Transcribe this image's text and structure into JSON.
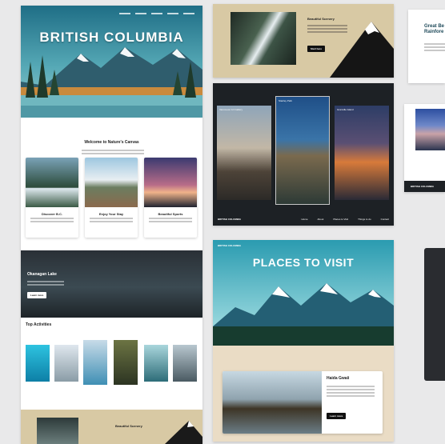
{
  "site": {
    "hero_title": "BRITISH COLUMBIA",
    "welcome_title": "Welcome to Nature's Canvas",
    "cards": [
      {
        "label": "Discover B.C."
      },
      {
        "label": "Enjoy Your Stay"
      },
      {
        "label": "Beautiful Sports"
      }
    ],
    "lake_title": "Okanagan Lake",
    "lake_button": "Learn more",
    "activities_title": "Top Activities",
    "scenery_title": "Beautiful Scenery"
  },
  "middle_top": {
    "scenery_title": "Beautiful Scenery",
    "button": "Start here"
  },
  "gallery": {
    "card_labels": [
      "Vancouver Art Gallery",
      "Stanley Park",
      "Granville Island"
    ],
    "footer_brand": "BRITISH COLUMBIA",
    "footer_nav": [
      "Home",
      "About",
      "Places to Visit",
      "Things to do",
      "Contact"
    ]
  },
  "places": {
    "brand": "BRITISH COLUMBIA",
    "title": "PLACES TO VISIT",
    "haida_title": "Haida Gwaii",
    "haida_button": "Learn more"
  },
  "right": {
    "heading": "Great Be Rainfore",
    "footer_brand": "BRITISH COLUMBIA"
  },
  "colors": {
    "sky": "#56a9b6",
    "tan": "#d8c9a4",
    "dark": "#20252a",
    "accent": "#3a9aa6"
  }
}
